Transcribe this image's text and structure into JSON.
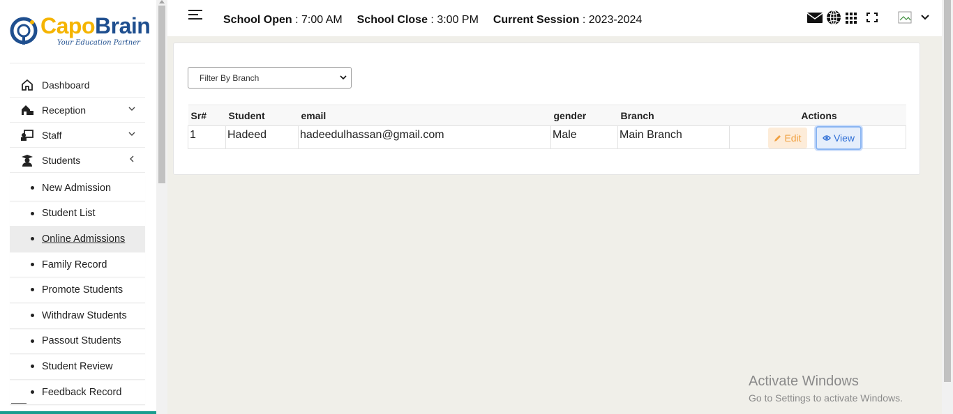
{
  "brand": {
    "name_part1": "Capo",
    "name_part2": "Brain",
    "tagline": "Your Education Partner"
  },
  "sidebar": {
    "items": [
      {
        "label": "Dashboard",
        "icon": "home-icon"
      },
      {
        "label": "Reception",
        "icon": "reception-icon",
        "expandable": true
      },
      {
        "label": "Staff",
        "icon": "staff-icon",
        "expandable": true
      },
      {
        "label": "Students",
        "icon": "student-icon",
        "expanded": true
      }
    ],
    "sub_items": [
      {
        "label": "New Admission"
      },
      {
        "label": "Student List"
      },
      {
        "label": "Online Admissions",
        "active": true
      },
      {
        "label": "Family Record"
      },
      {
        "label": "Promote Students"
      },
      {
        "label": "Withdraw Students"
      },
      {
        "label": "Passout Students"
      },
      {
        "label": "Student Review"
      },
      {
        "label": "Feedback Record"
      }
    ]
  },
  "header": {
    "school_open_label": "School Open",
    "school_open_value": "7:00 AM",
    "school_close_label": "School Close",
    "school_close_value": "3:00 PM",
    "session_label": "Current Session",
    "session_value": "2023-2024",
    "icons": [
      "mail-icon",
      "globe-icon",
      "apps-grid-icon",
      "fullscreen-icon",
      "profile-image-icon",
      "chevron-down-icon"
    ]
  },
  "filter": {
    "placeholder": "Filter By Branch"
  },
  "table": {
    "headers": {
      "sr": "Sr#",
      "student": "Student",
      "email": "email",
      "gender": "gender",
      "branch": "Branch",
      "actions": "Actions"
    },
    "rows": [
      {
        "sr": "1",
        "student": "Hadeed",
        "email": "hadeedulhassan@gmail.com",
        "gender": "Male",
        "branch": "Main Branch",
        "edit_label": "Edit",
        "view_label": "View"
      }
    ]
  },
  "watermark": {
    "line1": "Activate Windows",
    "line2": "Go to Settings to activate Windows."
  },
  "colors": {
    "accent_teal": "#1a9d8f",
    "logo_yellow": "#f5b400",
    "logo_blue": "#1f4f8f",
    "edit_orange": "#f0a040",
    "view_blue": "#2f6fd6"
  }
}
